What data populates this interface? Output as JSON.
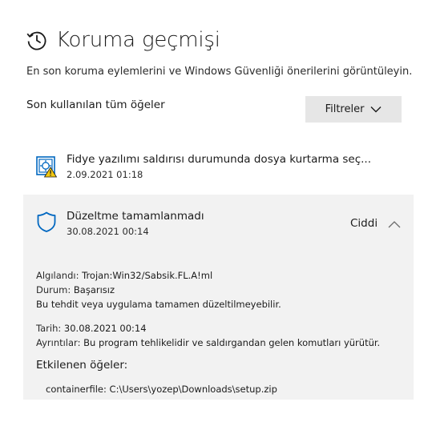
{
  "header": {
    "title": "Koruma geçmişi",
    "icon": "history-clock-icon",
    "subtitle": "En son koruma eylemlerini ve Windows Güvenliği önerilerini görüntüleyin."
  },
  "list": {
    "label": "Son kullanılan tüm öğeler",
    "filter_label": "Filtreler",
    "filter_icon": "chevron-down-icon"
  },
  "items": [
    {
      "icon": "ransomware-recovery-warning-icon",
      "title": "Fidye yazılımı saldırısı durumunda dosya kurtarma seç...",
      "date": "2.09.2021 01:18"
    },
    {
      "icon": "shield-icon",
      "title": "Düzeltme tamamlanmadı",
      "date": "30.08.2021 00:14",
      "severity": "Ciddi",
      "expanded_icon": "chevron-up-icon",
      "details": {
        "detected_key": "Algılandı:",
        "detected_value": "Trojan:Win32/Sabsik.FL.A!ml",
        "status_key": "Durum:",
        "status_value": "Başarısız",
        "note": "Bu tehdit veya uygulama tamamen düzeltilmeyebilir.",
        "date_key": "Tarih:",
        "date_value": "30.08.2021 00:14",
        "details_key": "Ayrıntılar:",
        "details_value": "Bu program tehlikelidir ve saldırgandan gelen komutları yürütür.",
        "affected_title": "Etkilenen öğeler:",
        "affected_file": "containerfile: C:\\Users\\yozep\\Downloads\\setup.zip"
      }
    }
  ],
  "colors": {
    "accent": "#0067c0",
    "warning": "#f2c811",
    "expanded_bg": "#f2f2f2",
    "button_bg": "#e6e6e6"
  }
}
